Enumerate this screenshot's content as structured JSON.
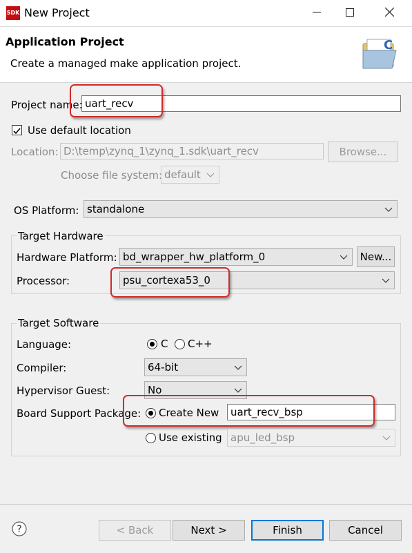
{
  "window": {
    "logo_text": "SDK",
    "title": "New Project"
  },
  "header": {
    "title": "Application Project",
    "description": "Create a managed make application project.",
    "icon": "new-project-wizard-icon"
  },
  "project_name": {
    "label": "Project name:",
    "value": "uart_recv"
  },
  "use_default_location": {
    "label": "Use default location",
    "checked": true
  },
  "location": {
    "label": "Location:",
    "value": "D:\\temp\\zynq_1\\zynq_1.sdk\\uart_recv",
    "browse_label": "Browse..."
  },
  "file_system": {
    "label": "Choose file system:",
    "value": "default"
  },
  "os_platform": {
    "label": "OS Platform:",
    "value": "standalone"
  },
  "target_hardware": {
    "title": "Target Hardware",
    "hardware_platform_label": "Hardware Platform:",
    "hardware_platform_value": "bd_wrapper_hw_platform_0",
    "new_label": "New...",
    "processor_label": "Processor:",
    "processor_value": "psu_cortexa53_0"
  },
  "target_software": {
    "title": "Target Software",
    "language_label": "Language:",
    "language_options": [
      "C",
      "C++"
    ],
    "language_selected": "C",
    "compiler_label": "Compiler:",
    "compiler_value": "64-bit",
    "hypervisor_label": "Hypervisor Guest:",
    "hypervisor_value": "No",
    "bsp_label": "Board Support Package:",
    "create_new_label": "Create New",
    "create_new_value": "uart_recv_bsp",
    "use_existing_label": "Use existing",
    "use_existing_value": "apu_led_bsp"
  },
  "footer": {
    "help_icon": "help-icon",
    "back_label": "< Back",
    "next_label": "Next >",
    "finish_label": "Finish",
    "cancel_label": "Cancel"
  },
  "colors": {
    "highlight": "#d02a2a",
    "default_button_border": "#0078d7"
  }
}
